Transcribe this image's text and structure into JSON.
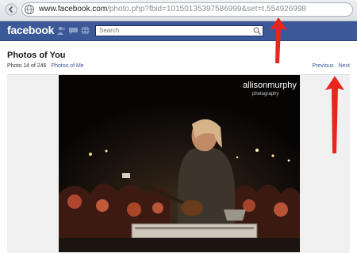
{
  "browser": {
    "url_prefix": "www.facebook.com",
    "url_rest": "/photo.php?fbid=10150135397586999&set=t.554926998"
  },
  "header": {
    "logo": "facebook",
    "search_placeholder": "Search"
  },
  "page": {
    "title": "Photos of You",
    "counter": "Photo 14 of 246",
    "photos_of_me_link": "Photos of Me",
    "previous_label": "Previous",
    "next_label": "Next"
  },
  "photo": {
    "watermark_name": "allisonmurphy",
    "watermark_sub": "photography"
  },
  "colors": {
    "facebook_blue": "#3b5998",
    "link_blue": "#3b5998",
    "arrow_red": "#e8261c"
  },
  "icons": [
    "back-forward-chevron-icon",
    "globe-icon",
    "friend-requests-icon",
    "messages-icon",
    "notifications-icon",
    "search-icon"
  ]
}
